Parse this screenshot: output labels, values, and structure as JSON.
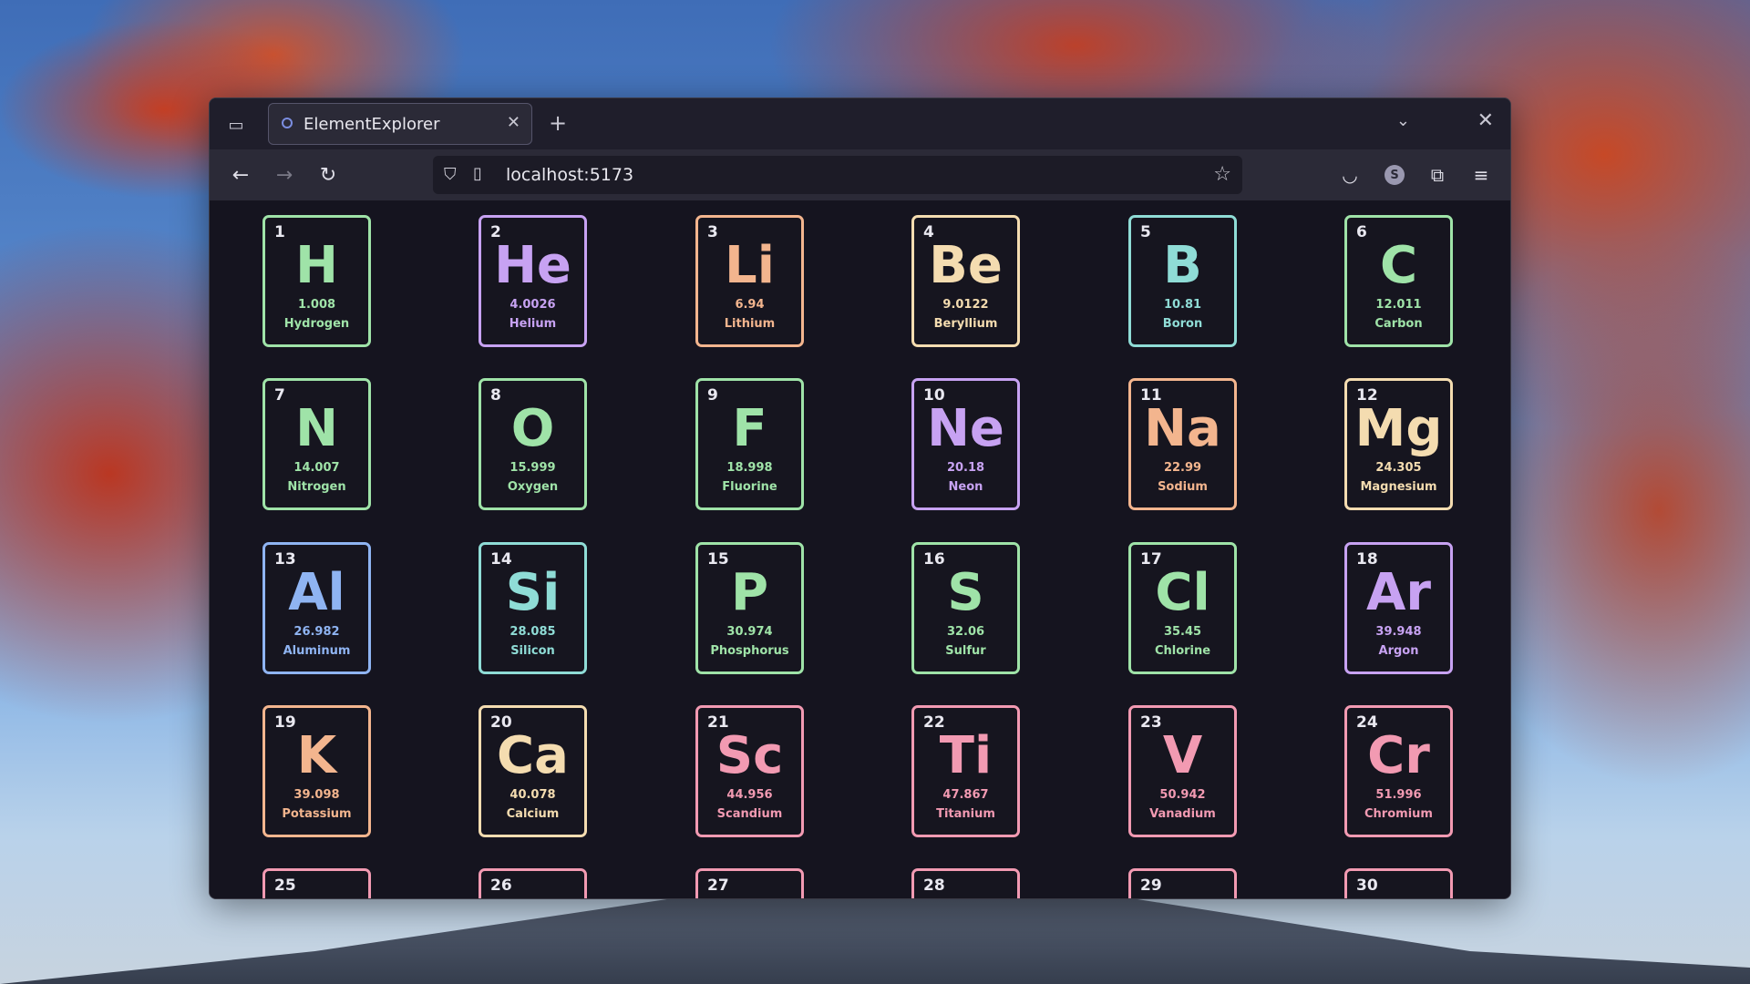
{
  "browser": {
    "tab_title": "ElementExplorer",
    "url": "localhost:5173",
    "icons": {
      "overview": "tab-overview-icon",
      "close": "close-icon",
      "new_tab": "plus-icon",
      "back": "arrow-left-icon",
      "forward": "arrow-right-icon",
      "reload": "reload-icon",
      "shield": "shield-icon",
      "page": "page-icon",
      "star": "star-icon",
      "pocket": "pocket-icon",
      "extensions": "puzzle-icon",
      "menu": "hamburger-menu-icon"
    },
    "avatar_letter": "S"
  },
  "elements": [
    {
      "number": "1",
      "symbol": "H",
      "mass": "1.008",
      "name": "Hydrogen",
      "color": "#9fe3a8"
    },
    {
      "number": "2",
      "symbol": "He",
      "mass": "4.0026",
      "name": "Helium",
      "color": "#c7a2f2"
    },
    {
      "number": "3",
      "symbol": "Li",
      "mass": "6.94",
      "name": "Lithium",
      "color": "#f3b58e"
    },
    {
      "number": "4",
      "symbol": "Be",
      "mass": "9.0122",
      "name": "Beryllium",
      "color": "#f4dcb0"
    },
    {
      "number": "5",
      "symbol": "B",
      "mass": "10.81",
      "name": "Boron",
      "color": "#8fdcd6"
    },
    {
      "number": "6",
      "symbol": "C",
      "mass": "12.011",
      "name": "Carbon",
      "color": "#9fe3a8"
    },
    {
      "number": "7",
      "symbol": "N",
      "mass": "14.007",
      "name": "Nitrogen",
      "color": "#9fe3a8"
    },
    {
      "number": "8",
      "symbol": "O",
      "mass": "15.999",
      "name": "Oxygen",
      "color": "#9fe3a8"
    },
    {
      "number": "9",
      "symbol": "F",
      "mass": "18.998",
      "name": "Fluorine",
      "color": "#9fe3a8"
    },
    {
      "number": "10",
      "symbol": "Ne",
      "mass": "20.18",
      "name": "Neon",
      "color": "#c7a2f2"
    },
    {
      "number": "11",
      "symbol": "Na",
      "mass": "22.99",
      "name": "Sodium",
      "color": "#f3b58e"
    },
    {
      "number": "12",
      "symbol": "Mg",
      "mass": "24.305",
      "name": "Magnesium",
      "color": "#f4dcb0"
    },
    {
      "number": "13",
      "symbol": "Al",
      "mass": "26.982",
      "name": "Aluminum",
      "color": "#8fb4f2"
    },
    {
      "number": "14",
      "symbol": "Si",
      "mass": "28.085",
      "name": "Silicon",
      "color": "#8fdcd6"
    },
    {
      "number": "15",
      "symbol": "P",
      "mass": "30.974",
      "name": "Phosphorus",
      "color": "#9fe3a8"
    },
    {
      "number": "16",
      "symbol": "S",
      "mass": "32.06",
      "name": "Sulfur",
      "color": "#9fe3a8"
    },
    {
      "number": "17",
      "symbol": "Cl",
      "mass": "35.45",
      "name": "Chlorine",
      "color": "#9fe3a8"
    },
    {
      "number": "18",
      "symbol": "Ar",
      "mass": "39.948",
      "name": "Argon",
      "color": "#c7a2f2"
    },
    {
      "number": "19",
      "symbol": "K",
      "mass": "39.098",
      "name": "Potassium",
      "color": "#f3b58e"
    },
    {
      "number": "20",
      "symbol": "Ca",
      "mass": "40.078",
      "name": "Calcium",
      "color": "#f4dcb0"
    },
    {
      "number": "21",
      "symbol": "Sc",
      "mass": "44.956",
      "name": "Scandium",
      "color": "#f29ab2"
    },
    {
      "number": "22",
      "symbol": "Ti",
      "mass": "47.867",
      "name": "Titanium",
      "color": "#f29ab2"
    },
    {
      "number": "23",
      "symbol": "V",
      "mass": "50.942",
      "name": "Vanadium",
      "color": "#f29ab2"
    },
    {
      "number": "24",
      "symbol": "Cr",
      "mass": "51.996",
      "name": "Chromium",
      "color": "#f29ab2"
    },
    {
      "number": "25",
      "symbol": "",
      "mass": "",
      "name": "",
      "color": "#f29ab2"
    },
    {
      "number": "26",
      "symbol": "",
      "mass": "",
      "name": "",
      "color": "#f29ab2"
    },
    {
      "number": "27",
      "symbol": "",
      "mass": "",
      "name": "",
      "color": "#f29ab2"
    },
    {
      "number": "28",
      "symbol": "",
      "mass": "",
      "name": "",
      "color": "#f29ab2"
    },
    {
      "number": "29",
      "symbol": "",
      "mass": "",
      "name": "",
      "color": "#f29ab2"
    },
    {
      "number": "30",
      "symbol": "",
      "mass": "",
      "name": "",
      "color": "#f29ab2"
    }
  ]
}
